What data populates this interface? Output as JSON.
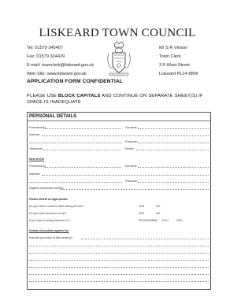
{
  "header": {
    "title": "LISKEARD TOWN COUNCIL",
    "left": {
      "tel": "Tel:  01579 345407",
      "fax": "Fax: 01579 324429",
      "email": "E-mail: townclerk@liskeard.gov.uk",
      "web": "Web Site:  www.liskeard.gov.uk"
    },
    "right": {
      "name": "Mr S R Vinson",
      "role": "Town Clerk",
      "street": "3-5 West Street",
      "town": "Liskeard PL14 6BW"
    }
  },
  "form_heading": "APPLICATION FORM CONFIDENTIAL",
  "instruction": {
    "pre": "PLEASE USE ",
    "bold": "BLOCK CAPITALS",
    "post": " AND CONTINUE ON SEPARATE SHEET(S) IF SPACE IS INADEQUATE"
  },
  "personal_details": {
    "title": "PERSONAL DETAILS",
    "forenames": "Forename(s):",
    "surname": "Surname:",
    "address": "Address:",
    "postcode": "Postcode:",
    "telephone": "Telephone:",
    "mobile": "Mobile:",
    "next_of_kin": "Next of Kin",
    "nok_forenames": "Forename(s):",
    "nok_surname": "Surname:",
    "nok_address": "Address:",
    "nok_postcode": "Postcode:",
    "nok_daytime": "Daytime telephone number:",
    "delete_note": "Please delete as appropriate:",
    "q_licence": "Do you have a current valid driving licence?",
    "q_car": "Do you have access to a car?",
    "q_licence_type": "If you have a driving licence is it:",
    "yes": "YES",
    "no": "NO",
    "provisional": "PROVISIONAL",
    "full": "FULL",
    "hgv": "HGV",
    "position_heading": "Details of position applied for",
    "q_vacancy": "How did you learn of this vacancy?"
  }
}
